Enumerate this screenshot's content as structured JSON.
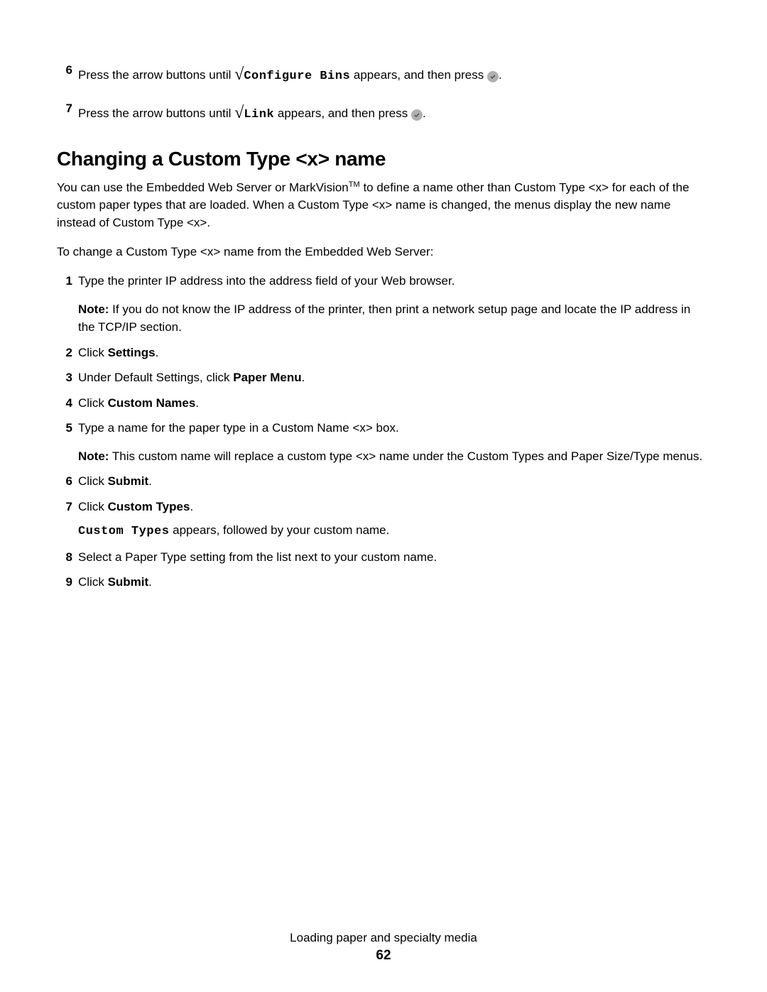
{
  "topSteps": [
    {
      "num": "6",
      "prefix": "Press the arrow buttons until ",
      "mono": "Configure Bins",
      "suffix": " appears, and then press "
    },
    {
      "num": "7",
      "prefix": "Press the arrow buttons until ",
      "mono": "Link",
      "suffix": " appears, and then press "
    }
  ],
  "sectionTitle": "Changing a Custom Type <x> name",
  "intro1_a": "You can use the Embedded Web Server or MarkVision",
  "intro1_tm": "TM",
  "intro1_b": " to define a name other than Custom Type <x> for each of the custom paper types that are loaded. When a Custom Type <x> name is changed, the menus display the new name instead of Custom Type <x>.",
  "intro2": "To change a Custom Type <x> name from the Embedded Web Server:",
  "steps": {
    "s1": {
      "num": "1",
      "text": "Type the printer IP address into the address field of your Web browser.",
      "note_label": "Note:",
      "note_text": " If you do not know the IP address of the printer, then print a network setup page and locate the IP address in the TCP/IP section."
    },
    "s2": {
      "num": "2",
      "pre": "Click ",
      "bold": "Settings",
      "post": "."
    },
    "s3": {
      "num": "3",
      "pre": "Under Default Settings, click ",
      "bold": "Paper Menu",
      "post": "."
    },
    "s4": {
      "num": "4",
      "pre": "Click ",
      "bold": "Custom Names",
      "post": "."
    },
    "s5": {
      "num": "5",
      "text": "Type a name for the paper type in a Custom Name <x> box.",
      "note_label": "Note:",
      "note_text": " This custom name will replace a custom type <x> name under the Custom Types and Paper Size/Type menus."
    },
    "s6": {
      "num": "6",
      "pre": "Click ",
      "bold": "Submit",
      "post": "."
    },
    "s7": {
      "num": "7",
      "pre": "Click ",
      "bold": "Custom Types",
      "post": ".",
      "sub_mono": "Custom Types",
      "sub_text": " appears, followed by your custom name."
    },
    "s8": {
      "num": "8",
      "text": "Select a Paper Type setting from the list next to your custom name."
    },
    "s9": {
      "num": "9",
      "pre": "Click ",
      "bold": "Submit",
      "post": "."
    }
  },
  "footer": {
    "section": "Loading paper and specialty media",
    "page": "62"
  }
}
